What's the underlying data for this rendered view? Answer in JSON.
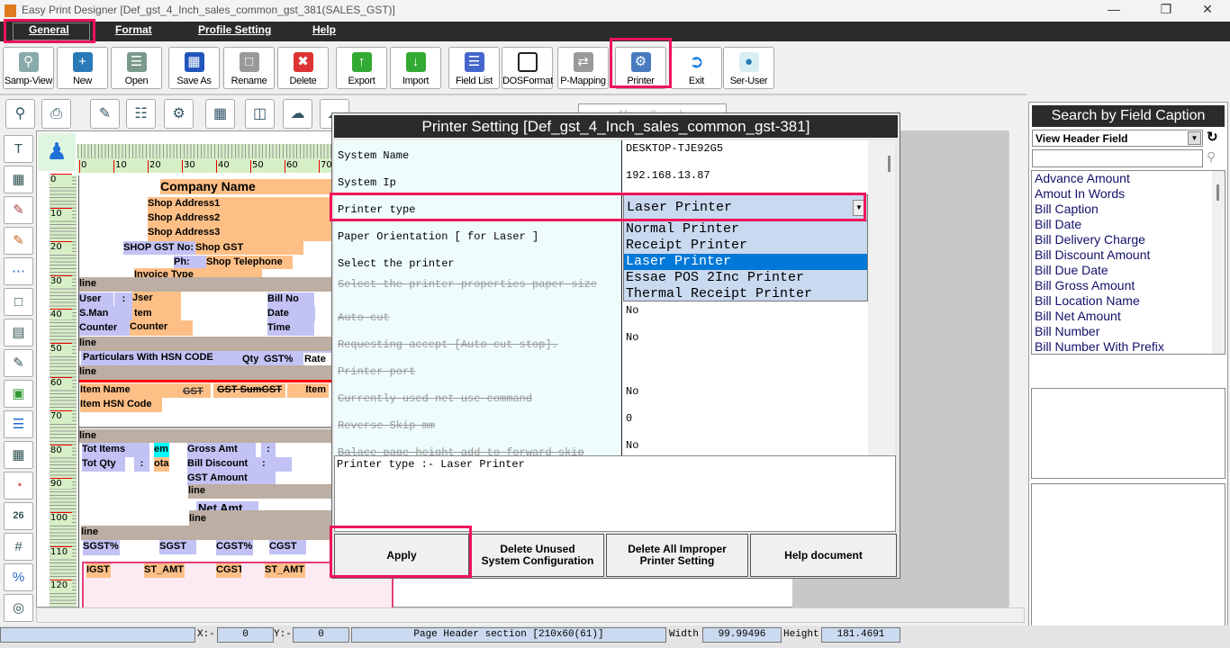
{
  "window": {
    "title": "Easy Print Designer [Def_gst_4_Inch_sales_common_gst_381(SALES_GST)]"
  },
  "menu": [
    "General",
    "Format",
    "Profile Setting",
    "Help"
  ],
  "toolbar": [
    "Samp-View",
    "New",
    "Open",
    "Save As",
    "Rename",
    "Delete",
    "Export",
    "Import",
    "Field List",
    "DOSFormat",
    "P-Mapping",
    "Printer",
    "Exit",
    "Ser-User"
  ],
  "menu_search_placeholder": "Menu Search",
  "ruler": {
    "top": [
      "0",
      "10",
      "20",
      "30",
      "40",
      "50",
      "60",
      "70"
    ],
    "left": [
      "0",
      "10",
      "20",
      "30",
      "40",
      "50",
      "60",
      "70",
      "80",
      "90",
      "100",
      "110",
      "120"
    ]
  },
  "canvas": {
    "company": "Company Name",
    "addr1": "Shop Address1",
    "addr2": "Shop Address2",
    "addr3": "Shop Address3",
    "gst_label": "SHOP GST No:",
    "gst": "Shop GST",
    "ph_label": "Ph:",
    "phone": "Shop Telephone",
    "invoice": "Invoice Type",
    "line": "line",
    "user": "User",
    "colon": ":",
    "user_val": "Jser",
    "sman": "S.Man",
    "sman_val": "tem",
    "counter": "Counter",
    "counter_val": "Counter",
    "billno": "Bill No",
    "date": "Date",
    "time": "Time",
    "particulars": "Particulars With HSN CODE",
    "qty": "Qty",
    "gstp": "GST%",
    "rate": "Rate",
    "item_name": "Item Name",
    "gst_strike": "GST",
    "gst_sum": "GST  SumGST",
    "item": "Item",
    "hsn": "Item HSN Code",
    "tot_items": "Tot Items",
    "em": "em",
    "tot_qty": "Tot Qty",
    "otal": "otal",
    "gross": "Gross Amt",
    "discount": "Bill Discount",
    "gst_amount": "GST Amount",
    "net": "Net Amt",
    "sgstp": "SGST%",
    "sgst": "SGST",
    "cgstp": "CGST%",
    "cgst": "CGST",
    "igst": "IGST",
    "st_amt": "ST_AMT"
  },
  "dialog": {
    "title": "Printer Setting [Def_gst_4_Inch_sales_common_gst-381]",
    "rows": [
      {
        "k": "System Name",
        "v": "DESKTOP-TJE92G5"
      },
      {
        "k": "System Ip",
        "v": "192.168.13.87"
      },
      {
        "k": "Printer type",
        "v": "Laser Printer"
      },
      {
        "k": "Paper Orientation [ for Laser ]",
        "v": ""
      },
      {
        "k": "Select the printer",
        "v": ""
      },
      {
        "k": "Select the printer properties paper size",
        "v": ""
      },
      {
        "k": "Auto cut",
        "v": "No"
      },
      {
        "k": "Requesting accept [Auto cut stop].",
        "v": "No"
      },
      {
        "k": "Printer port",
        "v": ""
      },
      {
        "k": "Currently used net use command",
        "v": "No"
      },
      {
        "k": "Reverse Skip mm",
        "v": "0"
      },
      {
        "k": "Balace page height add to forward skip",
        "v": "No"
      }
    ],
    "options": [
      "Normal Printer",
      "Receipt Printer",
      "Laser Printer",
      "Essae POS 2Inc Printer",
      "Thermal Receipt Printer"
    ],
    "selected_option": "Laser Printer",
    "description": "Printer type :- Laser Printer",
    "buttons": [
      "Apply",
      "Delete Unused\nSystem Configuration",
      "Delete All Improper\nPrinter Setting",
      "Help document"
    ]
  },
  "field_panel": {
    "title": "Search by Field Caption",
    "select": "View Header Field",
    "search": "",
    "items": [
      "Advance Amount",
      "Amout In Words",
      "Bill Caption",
      "Bill Date",
      "Bill Delivery Charge",
      "Bill Discount Amount",
      "Bill Due Date",
      "Bill Gross Amount",
      "Bill Location Name",
      "Bill Net Amount",
      "Bill Number",
      "Bill Number With Prefix"
    ]
  },
  "status": {
    "x_label": "X:-",
    "x": "0",
    "y_label": "Y:-",
    "y": "0",
    "section": "Page Header section [210x60(61)]",
    "width_label": "Width",
    "width": "99.99496",
    "height_label": "Height",
    "height": "181.4691"
  }
}
